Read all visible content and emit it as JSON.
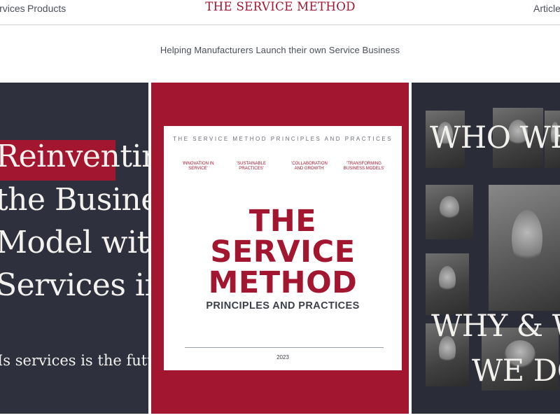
{
  "nav": {
    "services_label": "Services",
    "products_label": "Products",
    "articles_label": "Articles",
    "brand": "THE SERVICE METHOD"
  },
  "tagline": "Helping Manufacturers Launch their own Service Business",
  "left_panel": {
    "line1": "Reinventing",
    "line2": "the Business",
    "line3": "Model with",
    "line4": "Services in",
    "question": "Is services is the future?"
  },
  "book": {
    "top_line": "THE SERVICE METHOD PRINCIPLES AND PRACTICES",
    "pills": [
      "'INNOVATION IN SERVICE'",
      "'SUSTAINABLE PRACTICES'",
      "'COLLABORATION AND GROWTH'",
      "'TRANSFORMING BUSINESS MODELS'"
    ],
    "title_line1": "THE",
    "title_line2": "SERVICE",
    "title_line3": "METHOD",
    "subtitle": "PRINCIPLES AND PRACTICES",
    "year": "2023"
  },
  "right_panel": {
    "line1": "WHO WE ARE",
    "line2": "WHY & WHAT",
    "line3": "WE DO"
  },
  "colors": {
    "brand_red": "#a31630",
    "panel_dark": "#2e313d",
    "text_light": "#f4f2ee"
  }
}
